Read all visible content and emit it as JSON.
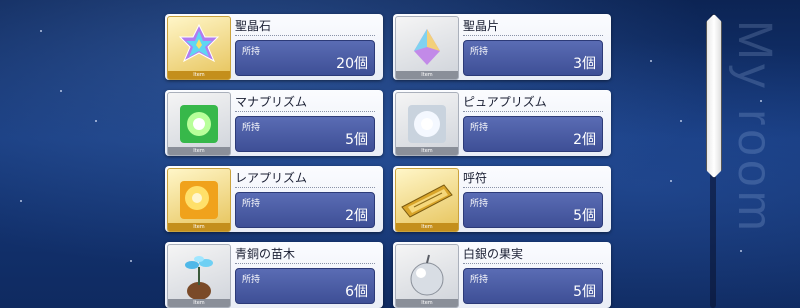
{
  "background_watermark": "My room",
  "owned_label": "所持",
  "item_tag": "Item",
  "items": [
    {
      "name": "聖晶石",
      "count": "20個",
      "icon": "saint-quartz-icon",
      "rarity": "gold"
    },
    {
      "name": "聖晶片",
      "count": "3個",
      "icon": "quartz-fragment-icon",
      "rarity": "grey"
    },
    {
      "name": "マナプリズム",
      "count": "5個",
      "icon": "mana-prism-icon",
      "rarity": "grey"
    },
    {
      "name": "ピュアプリズム",
      "count": "2個",
      "icon": "pure-prism-icon",
      "rarity": "grey"
    },
    {
      "name": "レアプリズム",
      "count": "2個",
      "icon": "rare-prism-icon",
      "rarity": "gold"
    },
    {
      "name": "呼符",
      "count": "5個",
      "icon": "summon-ticket-icon",
      "rarity": "gold"
    },
    {
      "name": "青銅の苗木",
      "count": "6個",
      "icon": "bronze-sapling-icon",
      "rarity": "grey"
    },
    {
      "name": "白銀の果実",
      "count": "5個",
      "icon": "silver-apple-icon",
      "rarity": "grey"
    }
  ],
  "colors": {
    "panel_blue": "#4a5ca6",
    "gold_frame": "#c48f1c",
    "background": "#15387a"
  }
}
